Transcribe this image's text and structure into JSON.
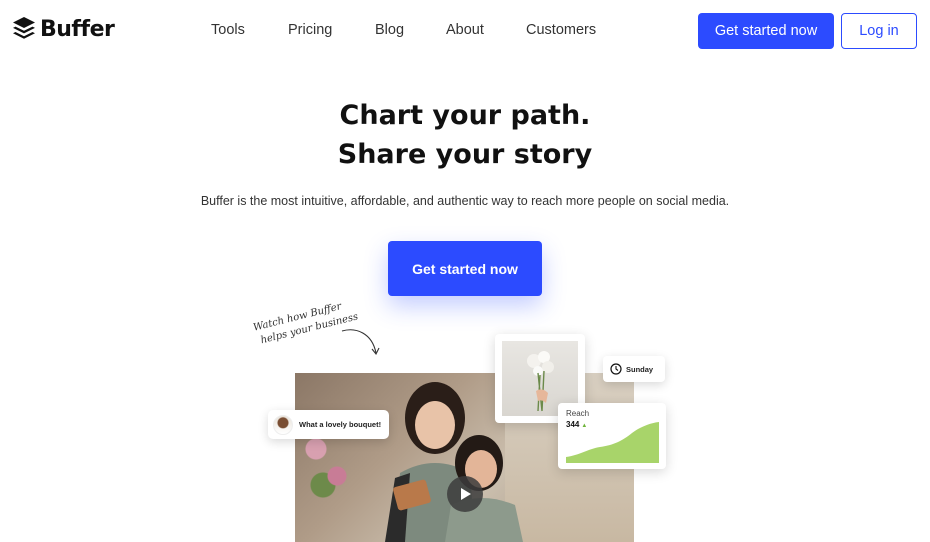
{
  "header": {
    "logo_text": "Buffer",
    "nav": [
      "Tools",
      "Pricing",
      "Blog",
      "About",
      "Customers"
    ],
    "cta_label": "Get started now",
    "login_label": "Log in"
  },
  "hero": {
    "title_line1": "Chart your path.",
    "title_line2": "Share your story",
    "subtitle": "Buffer is the most intuitive, affordable, and authentic way to reach more people on social media.",
    "cta_label": "Get started now"
  },
  "media": {
    "note_line1": "Watch how Buffer",
    "note_line2": "helps your business",
    "comment_text": "What a lovely bouquet!",
    "schedule_day": "Sunday",
    "reach_label": "Reach",
    "reach_value": "344"
  },
  "colors": {
    "brand": "#2c4bff",
    "chart_fill": "#a8d46a"
  },
  "icons": [
    "buffer-logo-icon",
    "clock-icon",
    "play-icon",
    "arrow-curve-icon",
    "up-arrow-icon"
  ]
}
